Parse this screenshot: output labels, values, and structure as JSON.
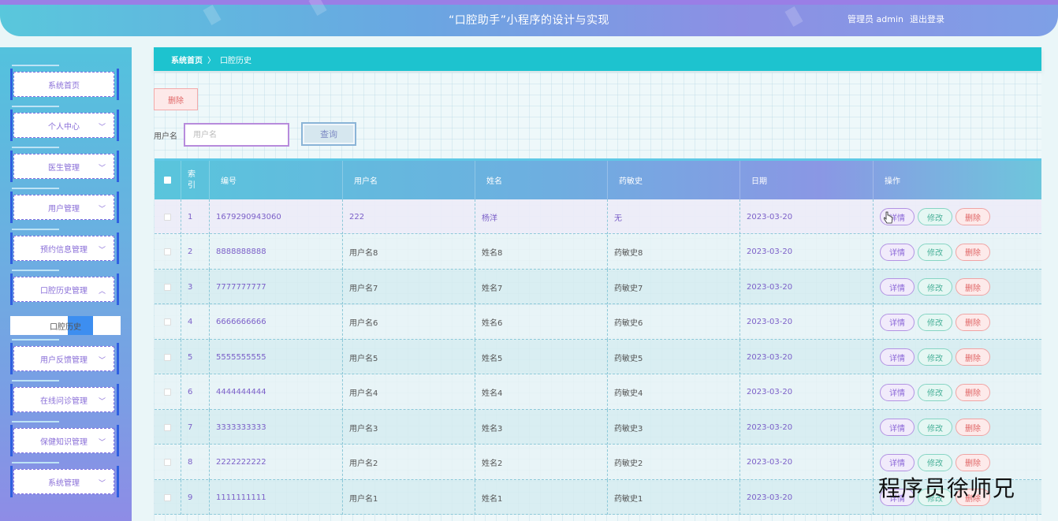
{
  "header": {
    "title": "“口腔助手”小程序的设计与实现",
    "user_label": "管理员 admin",
    "logout_label": "退出登录"
  },
  "sidebar": {
    "items": [
      {
        "label": "系统首页",
        "has_chevron": false
      },
      {
        "label": "个人中心",
        "has_chevron": true
      },
      {
        "label": "医生管理",
        "has_chevron": true
      },
      {
        "label": "用户管理",
        "has_chevron": true
      },
      {
        "label": "预约信息管理",
        "has_chevron": true
      },
      {
        "label": "口腔历史管理",
        "has_chevron": true,
        "expanded": true
      },
      {
        "label": "用户反馈管理",
        "has_chevron": true
      },
      {
        "label": "在线问诊管理",
        "has_chevron": true
      },
      {
        "label": "保健知识管理",
        "has_chevron": true
      },
      {
        "label": "系统管理",
        "has_chevron": true
      }
    ],
    "submenu": {
      "label": "口腔历史"
    }
  },
  "breadcrumb": {
    "home": "系统首页",
    "separator": "〉",
    "current": "口腔历史"
  },
  "toolbar": {
    "delete_label": "删除",
    "search_label": "用户名",
    "search_placeholder": "用户名",
    "query_label": "查询"
  },
  "table": {
    "headers": [
      "索引",
      "编号",
      "用户名",
      "姓名",
      "药敏史",
      "日期",
      "操作"
    ],
    "index_header_lines": [
      "索",
      "引"
    ],
    "op_labels": {
      "detail": "详情",
      "edit": "修改",
      "delete": "删除"
    },
    "rows": [
      {
        "index": "1",
        "number": "1679290943060",
        "username": "222",
        "name": "杨洋",
        "allergy": "无",
        "date": "2023-03-20"
      },
      {
        "index": "2",
        "number": "8888888888",
        "username": "用户名8",
        "name": "姓名8",
        "allergy": "药敏史8",
        "date": "2023-03-20"
      },
      {
        "index": "3",
        "number": "7777777777",
        "username": "用户名7",
        "name": "姓名7",
        "allergy": "药敏史7",
        "date": "2023-03-20"
      },
      {
        "index": "4",
        "number": "6666666666",
        "username": "用户名6",
        "name": "姓名6",
        "allergy": "药敏史6",
        "date": "2023-03-20"
      },
      {
        "index": "5",
        "number": "5555555555",
        "username": "用户名5",
        "name": "姓名5",
        "allergy": "药敏史5",
        "date": "2023-03-20"
      },
      {
        "index": "6",
        "number": "4444444444",
        "username": "用户名4",
        "name": "姓名4",
        "allergy": "药敏史4",
        "date": "2023-03-20"
      },
      {
        "index": "7",
        "number": "3333333333",
        "username": "用户名3",
        "name": "姓名3",
        "allergy": "药敏史3",
        "date": "2023-03-20"
      },
      {
        "index": "8",
        "number": "2222222222",
        "username": "用户名2",
        "name": "姓名2",
        "allergy": "药敏史2",
        "date": "2023-03-20"
      },
      {
        "index": "9",
        "number": "1111111111",
        "username": "用户名1",
        "name": "姓名1",
        "allergy": "药敏史1",
        "date": "2023-03-20"
      }
    ]
  },
  "watermark": "程序员徐师兄",
  "colors": {
    "accent_teal": "#1dc3cf",
    "accent_purple": "#8a6fd8",
    "delete_red": "#e06565",
    "edit_green": "#4ab19a"
  }
}
